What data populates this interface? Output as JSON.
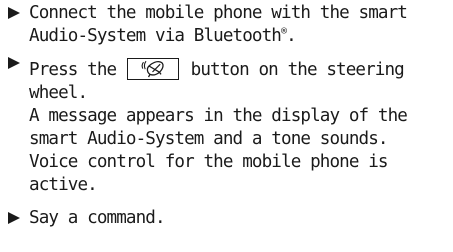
{
  "steps": [
    {
      "lines": [
        "Connect the mobile phone with the smart",
        "Audio-System via Bluetooth"
      ],
      "trademark": "®",
      "end": "."
    },
    {
      "before_icon": "Press the",
      "icon": "voice-control-icon",
      "after_icon": "button on the steering",
      "lines": [
        "wheel.",
        "A message appears in the display of the",
        "smart Audio-System and a tone sounds.",
        "Voice control for the mobile phone is",
        "active."
      ]
    },
    {
      "lines": [
        "Say a command."
      ]
    }
  ]
}
